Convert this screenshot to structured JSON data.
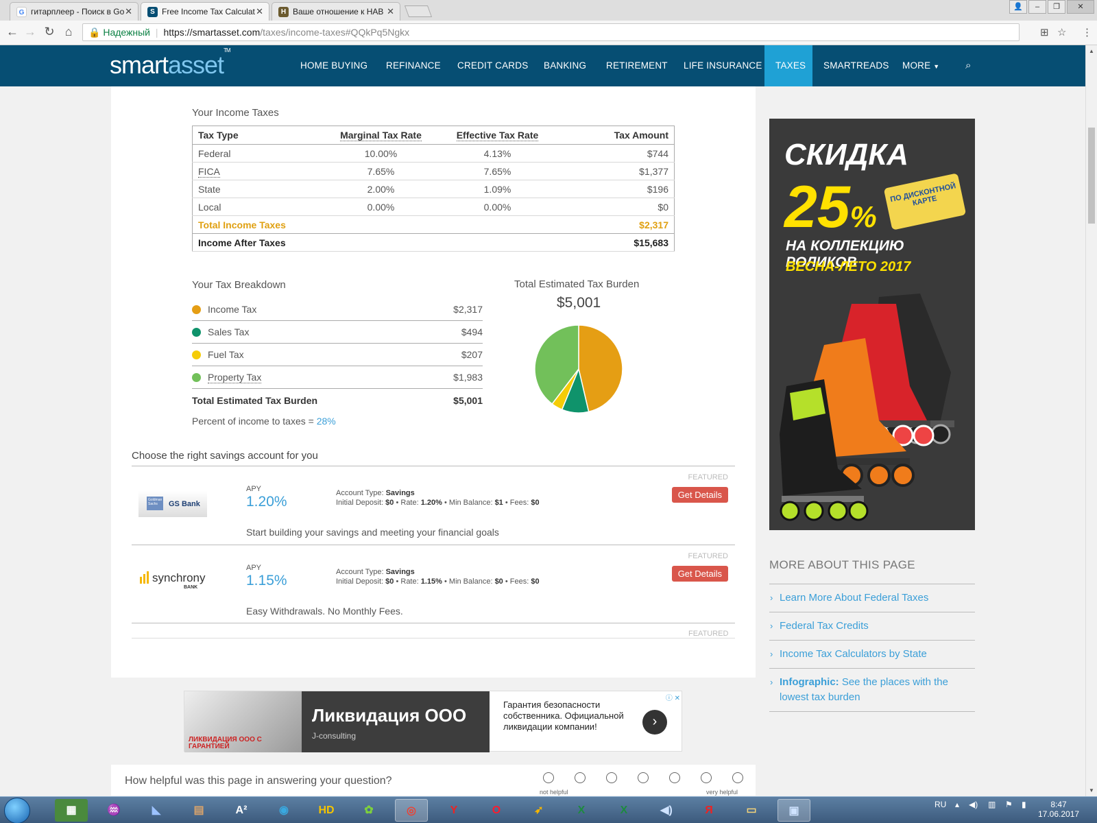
{
  "browser": {
    "tabs": [
      {
        "title": "гитарплеер - Поиск в Go",
        "favicon": "google-icon",
        "active": false
      },
      {
        "title": "Free Income Tax Calculat",
        "favicon": "smartasset-icon",
        "active": true
      },
      {
        "title": "Ваше отношение к HAB",
        "favicon": "habr-icon",
        "active": false
      }
    ],
    "security_label": "Надежный",
    "url_host": "https://smartasset.com",
    "url_path": "/taxes/income-taxes#QQkPq5Ngkx"
  },
  "site": {
    "logo_smart": "smart",
    "logo_asset": "asset",
    "logo_tm": "TM",
    "nav": [
      "HOME BUYING",
      "REFINANCE",
      "CREDIT CARDS",
      "BANKING",
      "RETIREMENT",
      "LIFE INSURANCE",
      "TAXES",
      "SMARTREADS",
      "MORE"
    ],
    "active_nav": "TAXES"
  },
  "income_taxes": {
    "title": "Your Income Taxes",
    "headers": [
      "Tax Type",
      "Marginal Tax Rate",
      "Effective Tax Rate",
      "Tax Amount"
    ],
    "rows": [
      [
        "Federal",
        "10.00%",
        "4.13%",
        "$744"
      ],
      [
        "FICA",
        "7.65%",
        "7.65%",
        "$1,377"
      ],
      [
        "State",
        "2.00%",
        "1.09%",
        "$196"
      ],
      [
        "Local",
        "0.00%",
        "0.00%",
        "$0"
      ]
    ],
    "total_label": "Total Income Taxes",
    "total_value": "$2,317",
    "after_label": "Income After Taxes",
    "after_value": "$15,683"
  },
  "breakdown": {
    "title": "Your Tax Breakdown",
    "items": [
      {
        "label": "Income Tax",
        "value": "$2,317",
        "color": "#e59e14"
      },
      {
        "label": "Sales Tax",
        "value": "$494",
        "color": "#0f936b"
      },
      {
        "label": "Fuel Tax",
        "value": "$207",
        "color": "#f5cc07"
      },
      {
        "label": "Property Tax",
        "value": "$1,983",
        "color": "#72c05a"
      }
    ],
    "total_label": "Total Estimated Tax Burden",
    "total_value": "$5,001",
    "percent_label": "Percent of income to taxes = ",
    "percent_value": "28%"
  },
  "burden": {
    "title": "Total Estimated Tax Burden",
    "value": "$5,001"
  },
  "chart_data": {
    "type": "pie",
    "categories": [
      "Income Tax",
      "Sales Tax",
      "Fuel Tax",
      "Property Tax"
    ],
    "values": [
      2317,
      494,
      207,
      1983
    ],
    "colors": [
      "#e59e14",
      "#0f936b",
      "#f5cc07",
      "#72c05a"
    ],
    "title": "Total Estimated Tax Burden"
  },
  "savings": {
    "title": "Choose the right savings account for you",
    "featured_label": "FEATURED",
    "apy_label": "APY",
    "button_label": "Get Details",
    "offers": [
      {
        "bank": "GS Bank",
        "bank_small": "Goldman Sachs",
        "apy": "1.20%",
        "account_type_label": "Account Type:",
        "account_type": "Savings",
        "deposit_label": "Initial Deposit:",
        "deposit": "$0",
        "rate_label": "Rate:",
        "rate": "1.20%",
        "min_label": "Min Balance:",
        "min": "$1",
        "fees_label": "Fees:",
        "fees": "$0",
        "tagline": "Start building your savings and meeting your financial goals"
      },
      {
        "bank": "synchrony",
        "bank_small": "BANK",
        "apy": "1.15%",
        "account_type_label": "Account Type:",
        "account_type": "Savings",
        "deposit_label": "Initial Deposit:",
        "deposit": "$0",
        "rate_label": "Rate:",
        "rate": "1.15%",
        "min_label": "Min Balance:",
        "min": "$0",
        "fees_label": "Fees:",
        "fees": "$0",
        "tagline": "Easy Withdrawals. No Monthly Fees."
      }
    ]
  },
  "sidebar_ad": {
    "headline": "СКИДКА",
    "discount": "25",
    "percent": "%",
    "card_text": "ПО ДИСКОНТНОЙ КАРТЕ",
    "line1": "НА КОЛЛЕКЦИЮ РОЛИКОВ",
    "line2": "ВЕСНА-ЛЕТО 2017"
  },
  "more_about": {
    "title": "MORE ABOUT THIS PAGE",
    "links": [
      {
        "bold": "",
        "text": "Learn More About Federal Taxes"
      },
      {
        "bold": "",
        "text": "Federal Tax Credits"
      },
      {
        "bold": "",
        "text": "Income Tax Calculators by State"
      },
      {
        "bold": "Infographic:",
        "text": " See the places with the lowest tax burden"
      }
    ]
  },
  "bottom_ad": {
    "image_caption": "ЛИКВИДАЦИЯ ООО С ГАРАНТИЕЙ",
    "title": "Ликвидация ООО",
    "sponsor": "J-consulting",
    "text": "Гарантия безопасности собственника. Официальной ликвидации компании!"
  },
  "helpful": {
    "question": "How helpful was this page in answering your question?",
    "low_label": "not helpful",
    "high_label": "very helpful"
  },
  "taskbar": {
    "lang": "RU",
    "time": "8:47",
    "date": "17.06.2017"
  }
}
